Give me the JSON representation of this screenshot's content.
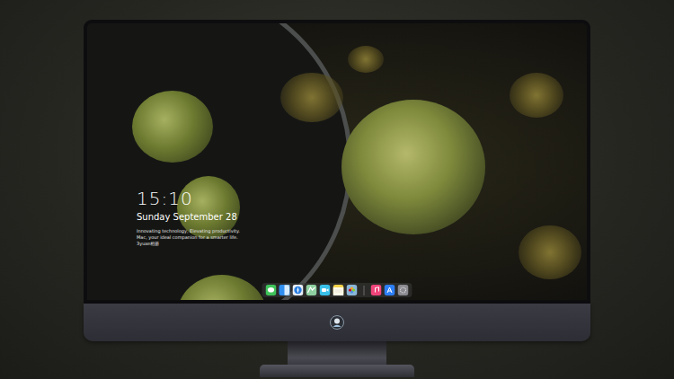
{
  "lock_screen": {
    "time": "15:10",
    "date": "Sunday September 28",
    "tagline": "Innovating technology, Elevating productivity. Mac, your ideal companion for a smarter life. 3yuxe相册"
  }
}
